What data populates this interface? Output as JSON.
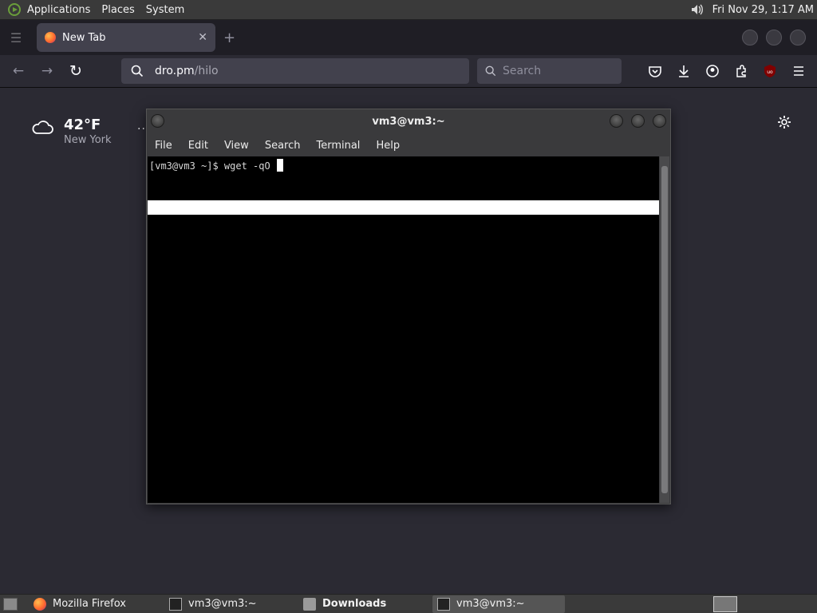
{
  "top_panel": {
    "menus": [
      "Applications",
      "Places",
      "System"
    ],
    "clock": "Fri Nov 29,  1:17 AM"
  },
  "firefox": {
    "tab_title": "New Tab",
    "url_domain": "dro.pm",
    "url_path": "/hilo",
    "search_placeholder": "Search",
    "weather_temp": "42°F",
    "weather_city": "New York"
  },
  "terminal": {
    "title": "vm3@vm3:~",
    "menus": [
      "File",
      "Edit",
      "View",
      "Search",
      "Terminal",
      "Help"
    ],
    "prompt_line": "[vm3@vm3 ~]$ wget -qO "
  },
  "taskbar": {
    "items": [
      "Mozilla Firefox",
      "vm3@vm3:~",
      "Downloads",
      "vm3@vm3:~"
    ]
  },
  "colors": {
    "panel_bg": "#3a3a3a",
    "firefox_bg": "#2b2a33",
    "terminal_bg": "#000000"
  }
}
